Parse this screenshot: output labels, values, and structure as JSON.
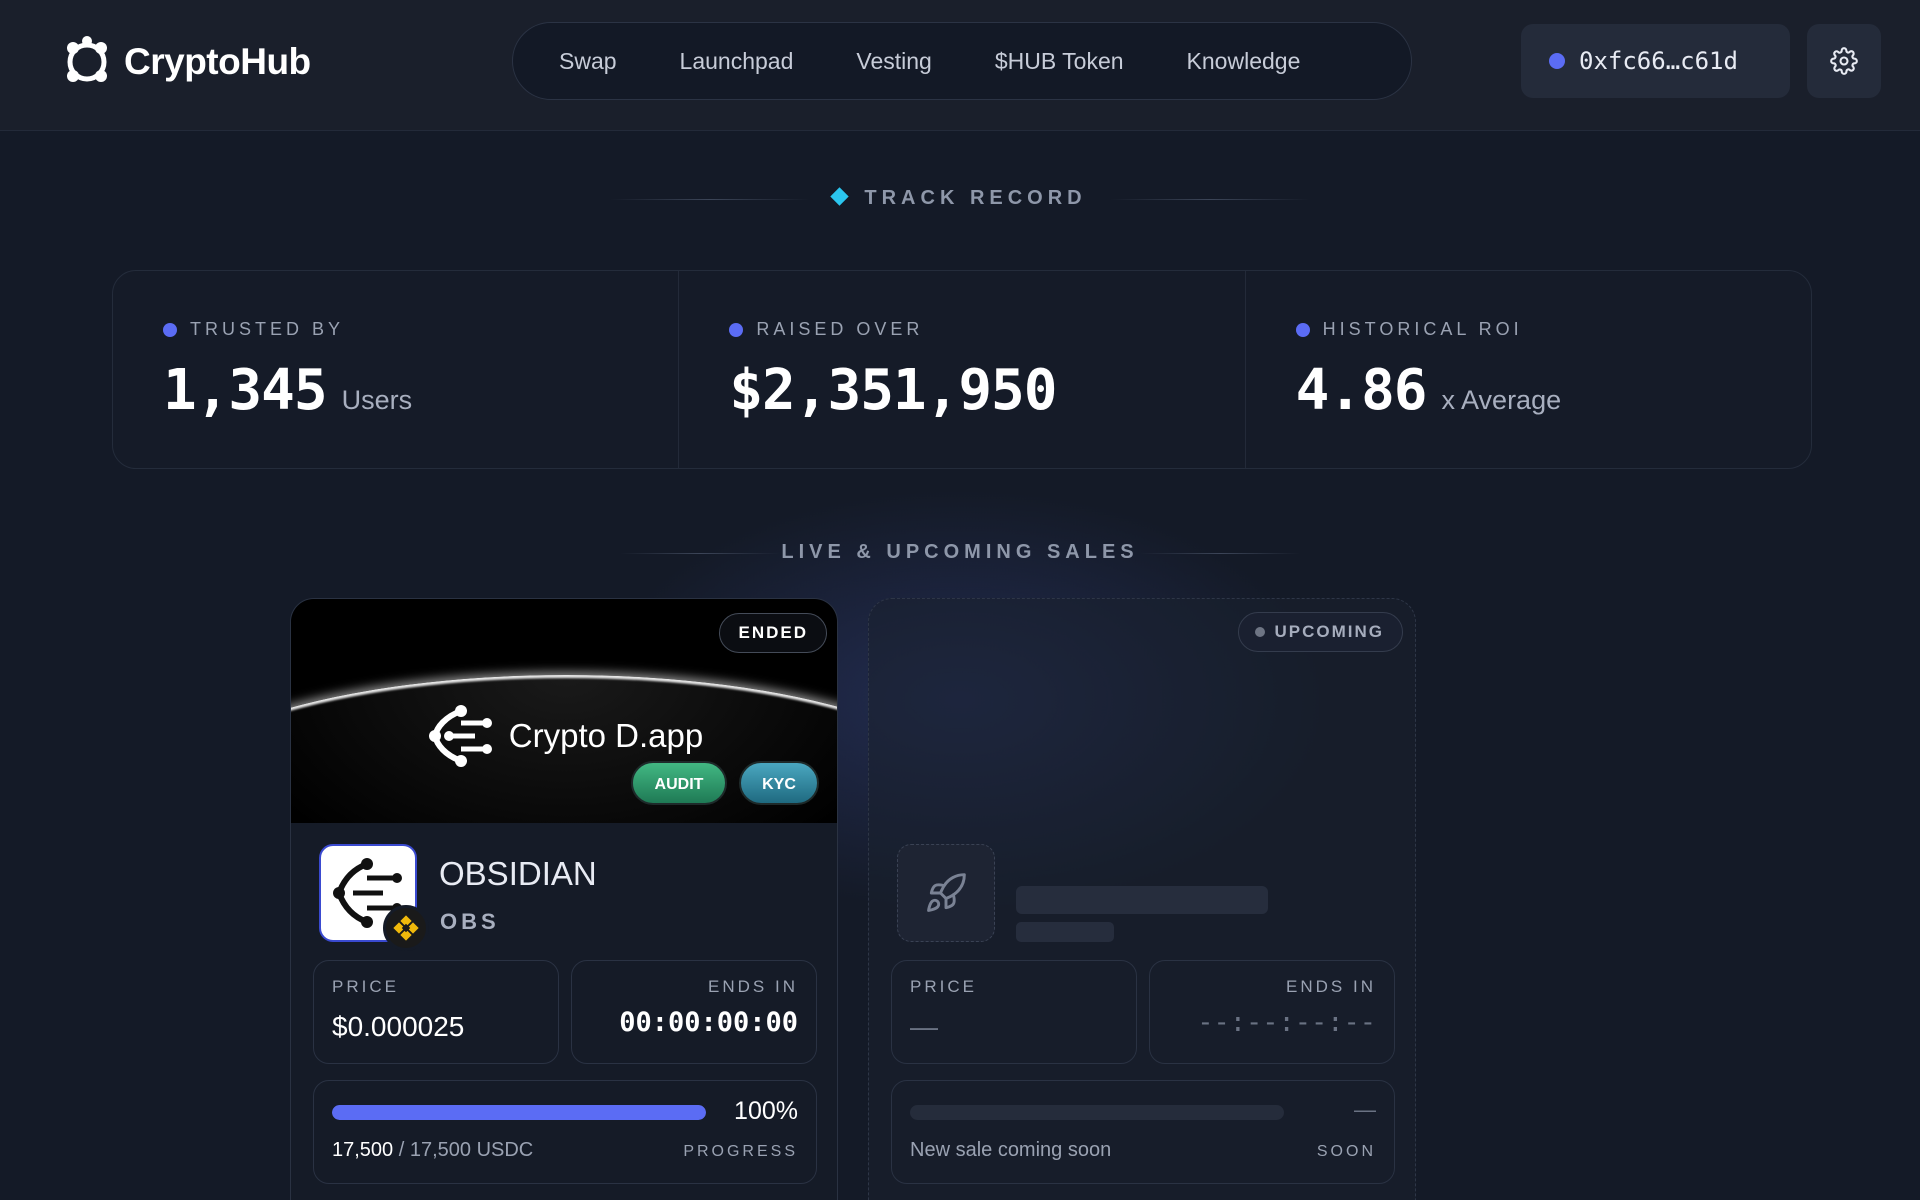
{
  "header": {
    "brand": "CryptoHub",
    "nav": [
      "Swap",
      "Launchpad",
      "Vesting",
      "$HUB Token",
      "Knowledge"
    ],
    "wallet_address": "0xfc66…c61d"
  },
  "track_record": {
    "title": "TRACK RECORD",
    "stats": [
      {
        "label": "TRUSTED BY",
        "value": "1,345",
        "unit": "Users"
      },
      {
        "label": "RAISED OVER",
        "value": "$2,351,950",
        "unit": ""
      },
      {
        "label": "HISTORICAL ROI",
        "value": "4.86",
        "unit": "x Average"
      }
    ]
  },
  "sales": {
    "title": "LIVE & UPCOMING SALES",
    "ended_card": {
      "status": "ENDED",
      "banner_brand": "Crypto D.app",
      "tags": [
        "AUDIT",
        "KYC"
      ],
      "name": "OBSIDIAN",
      "symbol": "OBS",
      "price_label": "PRICE",
      "price": "$0.000025",
      "ends_label": "ENDS IN",
      "ends_in": "00:00:00:00",
      "progress_pct_text": "100%",
      "progress_fraction": 1.0,
      "raised": "17,500",
      "goal": "/ 17,500 USDC",
      "progress_label": "PROGRESS"
    },
    "upcoming_card": {
      "status": "UPCOMING",
      "price_label": "PRICE",
      "price": "—",
      "ends_label": "ENDS IN",
      "ends_in": "--:--:--:--",
      "progress_value": "—",
      "note": "New sale coming soon",
      "progress_label": "SOON"
    }
  },
  "colors": {
    "accent": "#5b6cf4",
    "cyan": "#2bc6ef",
    "background": "#141a27",
    "audit_green": "#42b883",
    "kyc_teal": "#4aa7c0"
  },
  "icons": {
    "logo": "cryptohub-logo-icon",
    "settings": "gear-icon",
    "chain": "bnb-chain-icon",
    "placeholder": "rocket-icon"
  }
}
